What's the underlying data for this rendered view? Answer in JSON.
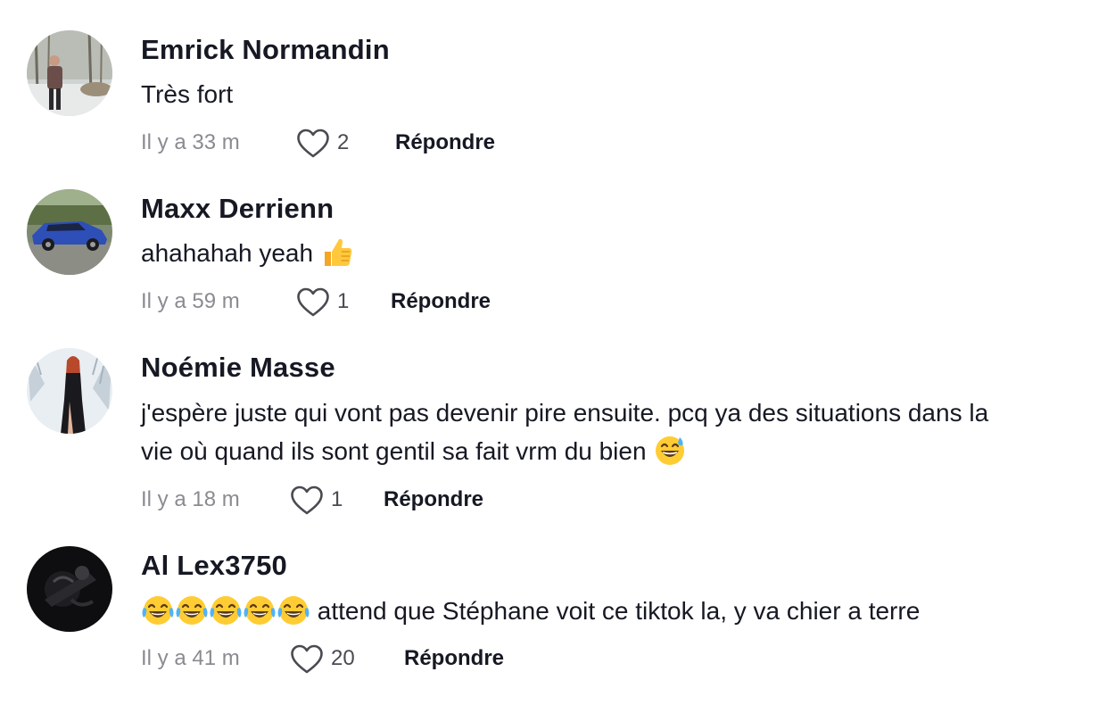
{
  "comments": [
    {
      "username": "Emrick Normandin",
      "text": "Très fort",
      "time": "Il y a 33 m",
      "likes": "2",
      "reply_label": "Répondre",
      "avatar": "person-in-snowy-forest"
    },
    {
      "username": "Maxx Derrienn",
      "text": "ahahahah yeah",
      "text_emoji": "thumbs-up-emoji",
      "time": "Il y a 59 m",
      "likes": "1",
      "reply_label": "Répondre",
      "avatar": "blue-sports-car"
    },
    {
      "username": "Noémie Masse",
      "text_line1": "j'espère juste qui vont pas devenir pire ensuite. pcq ya des situations dans la",
      "text_line2": "vie où quand ils sont gentil sa fait vrm du bien",
      "text_emoji": "grinning-sweat-emoji",
      "time": "Il y a 18 m",
      "likes": "1",
      "reply_label": "Répondre",
      "avatar": "woman-in-snow"
    },
    {
      "username": "Al Lex3750",
      "text": "attend que Stéphane voit ce tiktok la, y va chier a terre",
      "text_emoji": "tears-of-joy-emoji",
      "text_emoji_count": 5,
      "time": "Il y a 41 m",
      "likes": "20",
      "reply_label": "Répondre",
      "avatar": "dark-figure-photo"
    }
  ],
  "colors": {
    "text_primary": "#161823",
    "text_secondary": "#8a8b91",
    "background": "#ffffff"
  }
}
